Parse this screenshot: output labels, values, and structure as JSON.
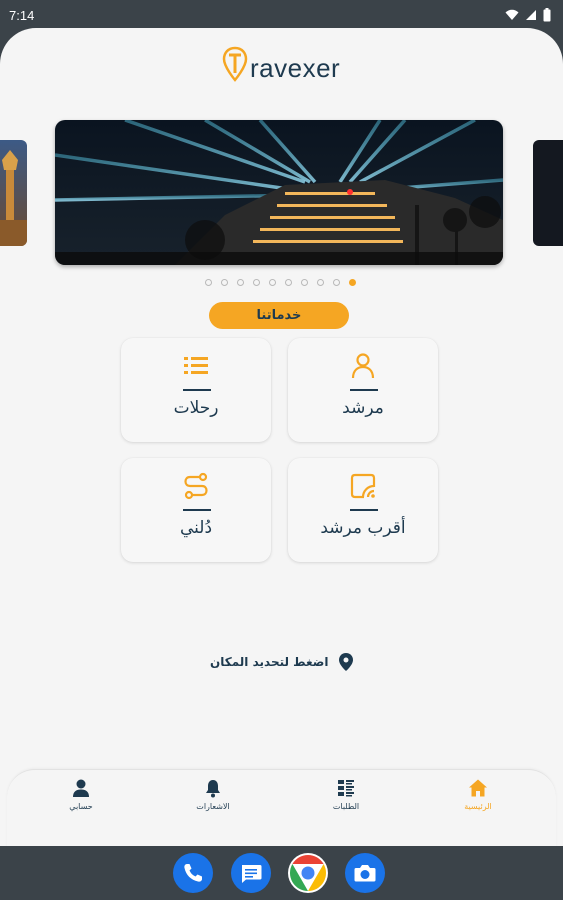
{
  "status_bar": {
    "time": "7:14",
    "icons": [
      "wifi-icon",
      "signal-icon",
      "battery-icon"
    ]
  },
  "logo": {
    "mark": "T",
    "text": "ravexer"
  },
  "carousel": {
    "slide_count": 10,
    "active_index": 9,
    "main_image": "night-building-with-light-beams"
  },
  "services": {
    "title": "خدماتنا",
    "items": [
      {
        "label": "مرشد",
        "icon": "person-icon"
      },
      {
        "label": "رحلات",
        "icon": "list-icon"
      },
      {
        "label": "أقرب مرشد",
        "icon": "nearby-signal-icon"
      },
      {
        "label": "دُلني",
        "icon": "route-icon"
      }
    ]
  },
  "location": {
    "text": "اضغط لتحديد المكان",
    "icon": "location-pin-icon"
  },
  "bottom_nav": {
    "items": [
      {
        "label": "حسابي",
        "icon": "account-icon",
        "active": false
      },
      {
        "label": "الاشعارات",
        "icon": "bell-icon",
        "active": false
      },
      {
        "label": "الطلبات",
        "icon": "orders-icon",
        "active": false
      },
      {
        "label": "الرئيسية",
        "icon": "home-icon",
        "active": true
      }
    ]
  },
  "system_dock": {
    "apps": [
      "phone-icon",
      "messages-icon",
      "chrome-icon",
      "camera-icon"
    ]
  },
  "colors": {
    "accent": "#f5a623",
    "primary": "#1e3a4f",
    "background": "#f5f5f5",
    "system": "#3b4349"
  }
}
